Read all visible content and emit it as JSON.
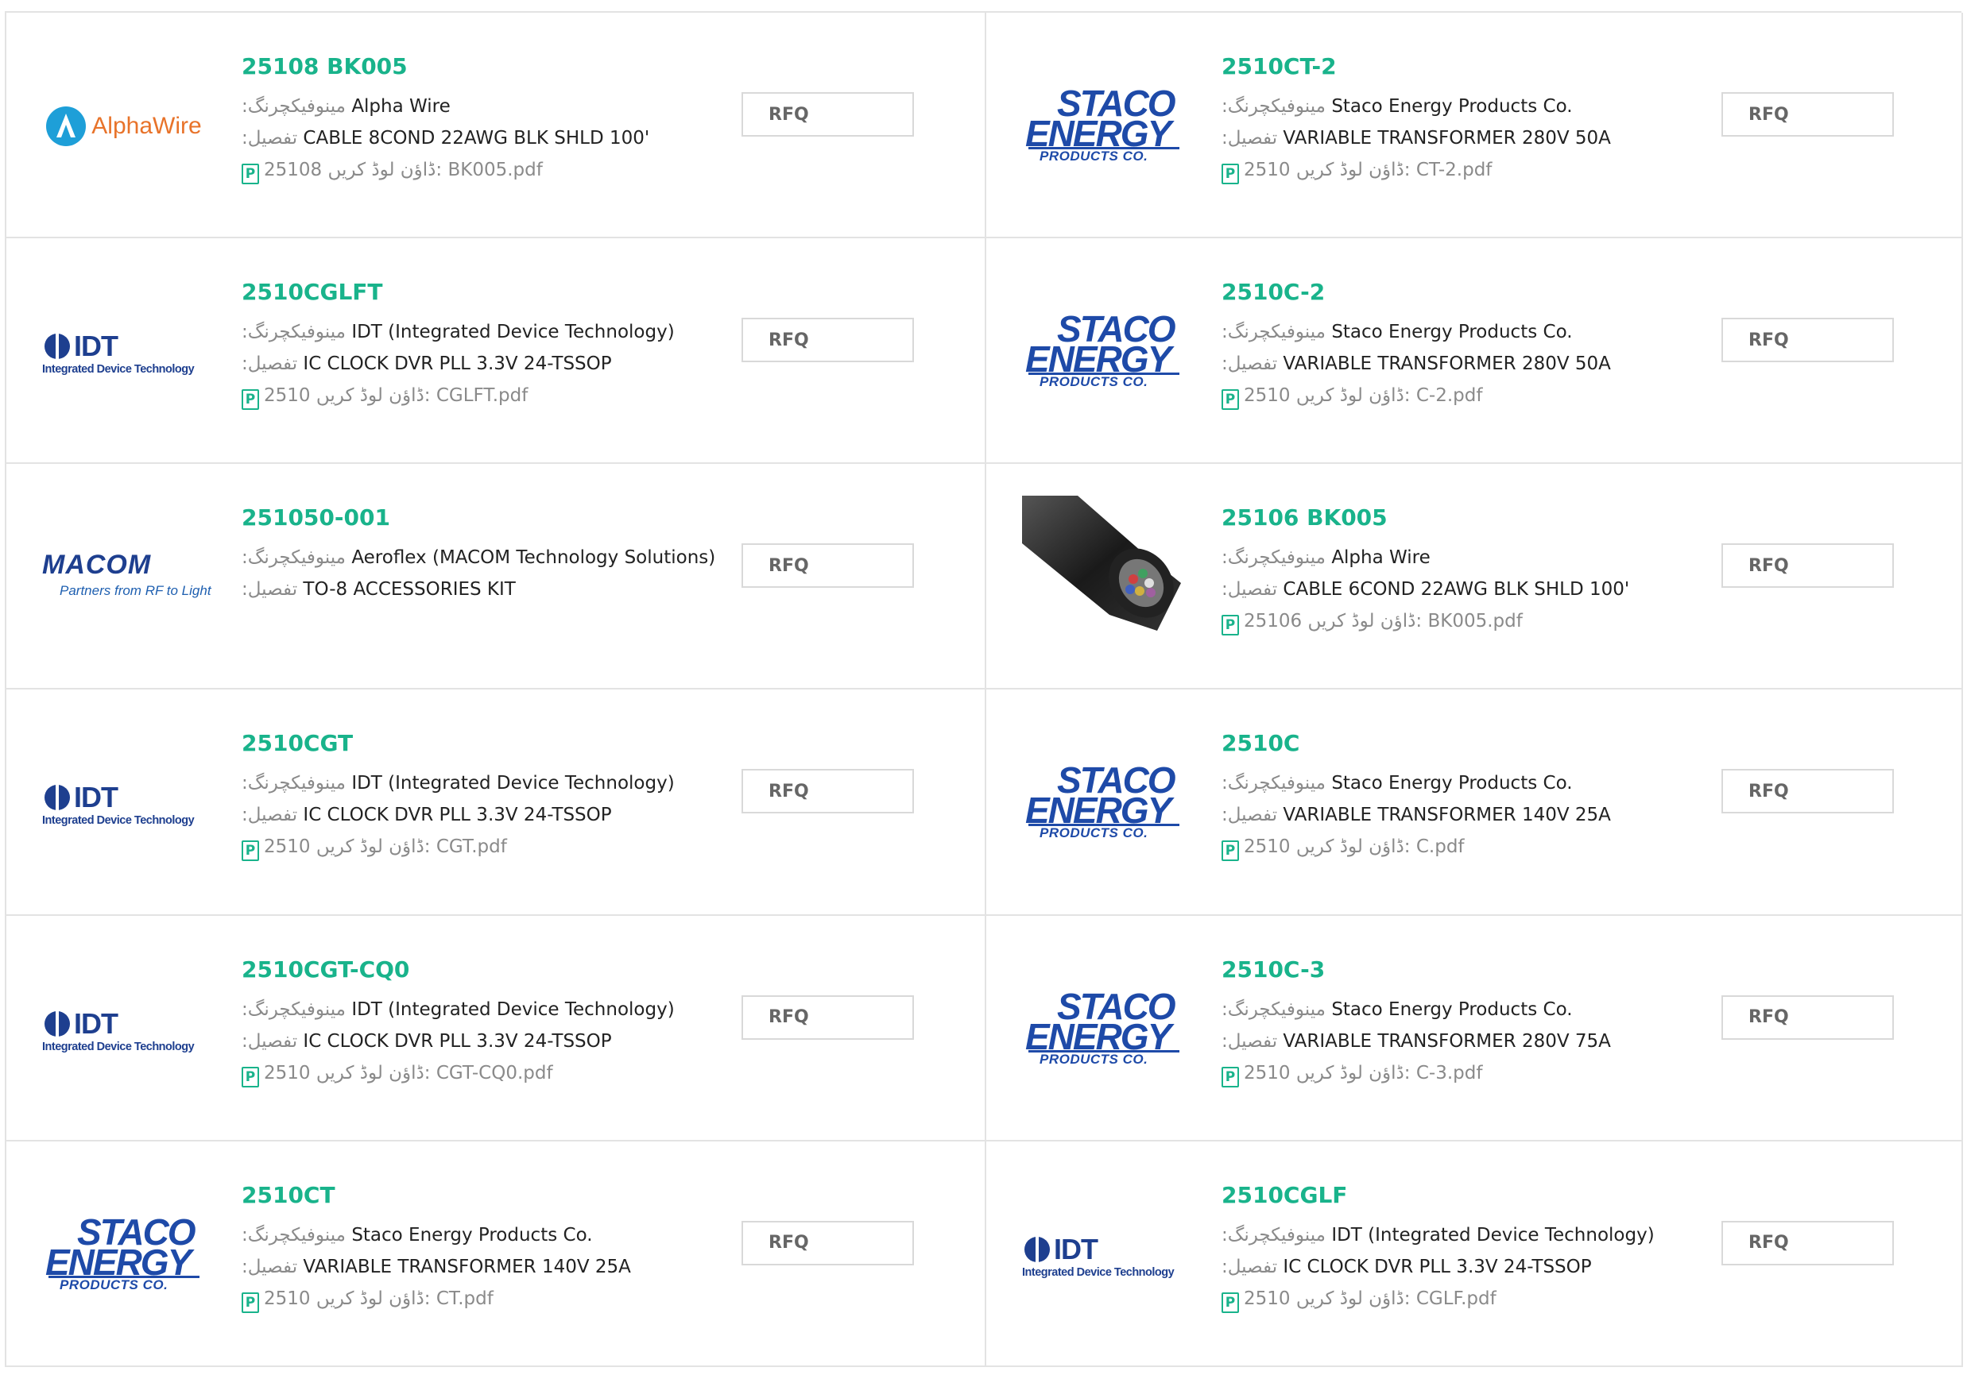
{
  "labels": {
    "manufacturer": ":مینوفیکچرنگ",
    "detail": ":تفصیل",
    "download": "ڈاؤن لوڈ کریں:",
    "rfq": "RFQ",
    "pdf_icon_glyph": "P"
  },
  "products": [
    {
      "part": "25108 BK005",
      "manufacturer": "Alpha Wire",
      "detail": "CABLE 8COND 22AWG BLK SHLD 100'",
      "download_prefix": "25108",
      "download_file": "BK005.pdf",
      "logo": "alphawire-logo",
      "logo_text": "AlphaWire"
    },
    {
      "part": "2510CT-2",
      "manufacturer": "Staco Energy Products Co.",
      "detail": "VARIABLE TRANSFORMER 280V 50A",
      "download_prefix": "2510",
      "download_file": "CT-2.pdf",
      "logo": "staco-energy-logo",
      "logo_text": "STACO ENERGY PRODUCTS CO."
    },
    {
      "part": "2510CGLFT",
      "manufacturer": "IDT (Integrated Device Technology)",
      "detail": "IC CLOCK DVR PLL 3.3V 24-TSSOP",
      "download_prefix": "2510",
      "download_file": "CGLFT.pdf",
      "logo": "idt-logo",
      "logo_text": "IDT Integrated Device Technology"
    },
    {
      "part": "2510C-2",
      "manufacturer": "Staco Energy Products Co.",
      "detail": "VARIABLE TRANSFORMER 280V 50A",
      "download_prefix": "2510",
      "download_file": "C-2.pdf",
      "logo": "staco-energy-logo",
      "logo_text": "STACO ENERGY PRODUCTS CO."
    },
    {
      "part": "251050-001",
      "manufacturer": "Aeroflex (MACOM Technology Solutions)",
      "detail": "TO-8 ACCESSORIES KIT",
      "download_prefix": "",
      "download_file": "",
      "logo": "macom-logo",
      "logo_text": "MACOM Partners from RF to Light"
    },
    {
      "part": "25106 BK005",
      "manufacturer": "Alpha Wire",
      "detail": "CABLE 6COND 22AWG BLK SHLD 100'",
      "download_prefix": "25106",
      "download_file": "BK005.pdf",
      "logo": "cable-photo",
      "logo_text": ""
    },
    {
      "part": "2510CGT",
      "manufacturer": "IDT (Integrated Device Technology)",
      "detail": "IC CLOCK DVR PLL 3.3V 24-TSSOP",
      "download_prefix": "2510",
      "download_file": "CGT.pdf",
      "logo": "idt-logo",
      "logo_text": "IDT Integrated Device Technology"
    },
    {
      "part": "2510C",
      "manufacturer": "Staco Energy Products Co.",
      "detail": "VARIABLE TRANSFORMER 140V 25A",
      "download_prefix": "2510",
      "download_file": "C.pdf",
      "logo": "staco-energy-logo",
      "logo_text": "STACO ENERGY PRODUCTS CO."
    },
    {
      "part": "2510CGT-CQ0",
      "manufacturer": "IDT (Integrated Device Technology)",
      "detail": "IC CLOCK DVR PLL 3.3V 24-TSSOP",
      "download_prefix": "2510",
      "download_file": "CGT-CQ0.pdf",
      "logo": "idt-logo",
      "logo_text": "IDT Integrated Device Technology"
    },
    {
      "part": "2510C-3",
      "manufacturer": "Staco Energy Products Co.",
      "detail": "VARIABLE TRANSFORMER 280V 75A",
      "download_prefix": "2510",
      "download_file": "C-3.pdf",
      "logo": "staco-energy-logo",
      "logo_text": "STACO ENERGY PRODUCTS CO."
    },
    {
      "part": "2510CT",
      "manufacturer": "Staco Energy Products Co.",
      "detail": "VARIABLE TRANSFORMER 140V 25A",
      "download_prefix": "2510",
      "download_file": "CT.pdf",
      "logo": "staco-energy-logo",
      "logo_text": "STACO ENERGY PRODUCTS CO."
    },
    {
      "part": "2510CGLF",
      "manufacturer": "IDT (Integrated Device Technology)",
      "detail": "IC CLOCK DVR PLL 3.3V 24-TSSOP",
      "download_prefix": "2510",
      "download_file": "CGLF.pdf",
      "logo": "idt-logo",
      "logo_text": "IDT Integrated Device Technology"
    }
  ],
  "colors": {
    "accent": "#19b38b",
    "border": "#e3e3e3",
    "label": "#8a8a8a",
    "logo_blue": "#1e4aa8",
    "alphawire_orange": "#e8732a"
  }
}
